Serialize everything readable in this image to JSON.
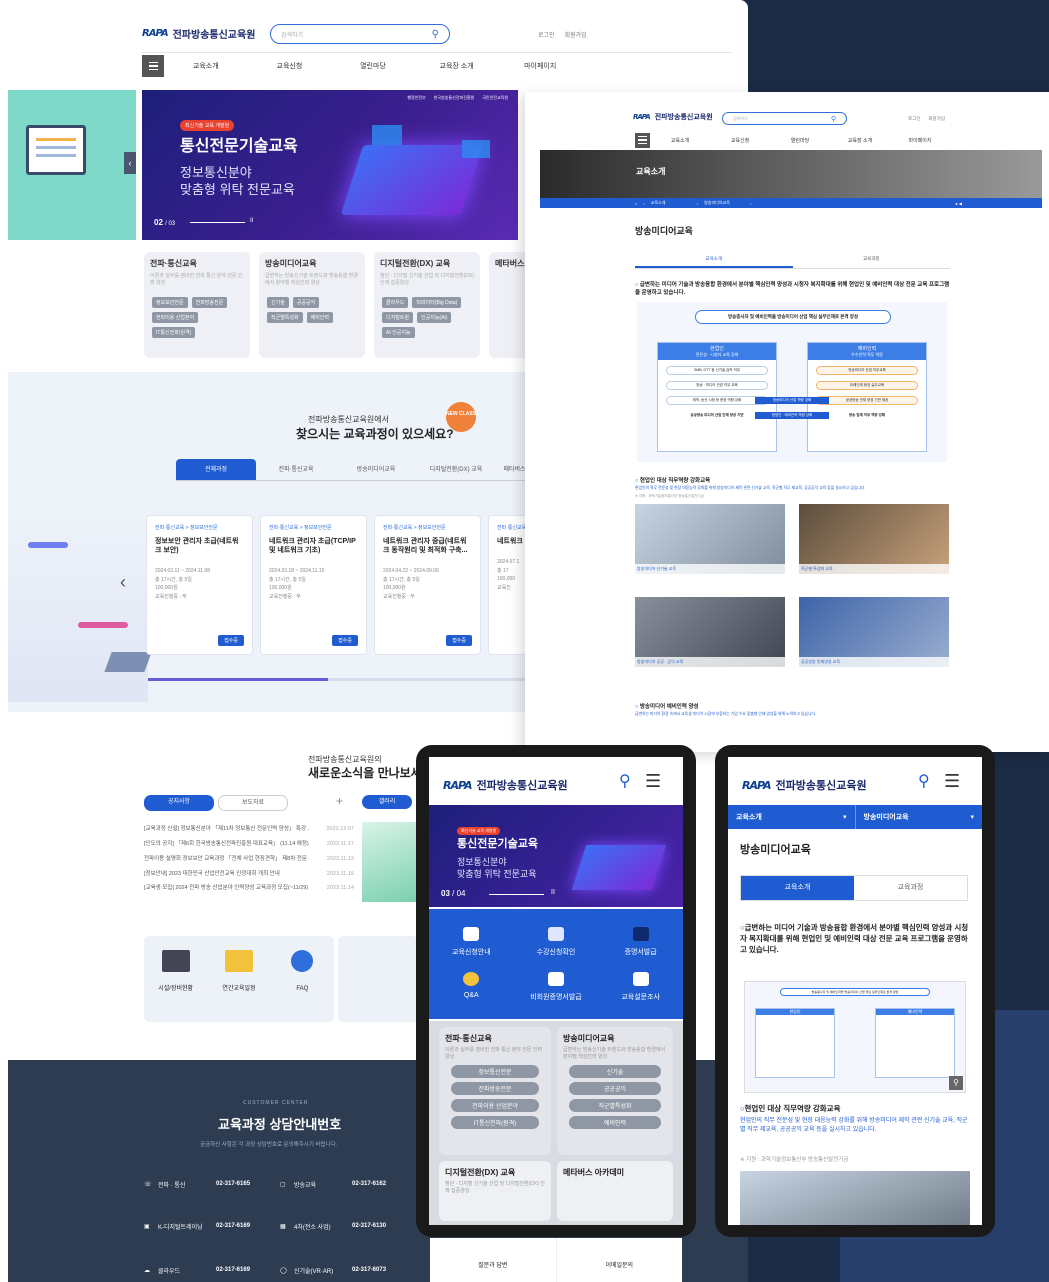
{
  "site": {
    "logo_mark": "RAPA",
    "logo_text": "전파방송통신교육원",
    "search_placeholder": "검색하기",
    "util": [
      "로그인",
      "회원가입"
    ]
  },
  "nav": [
    "교육소개",
    "교육신청",
    "열린마당",
    "교육장 소개",
    "마이페이지"
  ],
  "hero": {
    "badge": "최신기술 교육 개발원",
    "title": "통신전문기술교육",
    "sub1": "정보통신분야",
    "sub2": "맞춤형 위탁 전문교육",
    "counter": "02",
    "counter_total": "/ 03",
    "pause": "II",
    "partners": [
      "행정안전부",
      "한국방송통신전파진흥원",
      "국민안전교육원"
    ]
  },
  "categories": [
    {
      "title": "전파·통신교육",
      "desc": "이론과 실무를 겸비한 전파 통신 분야 전문 인력 양성",
      "tags": [
        "정보보안전문",
        "전파방송전문",
        "전파이용 산업분야",
        "IT통신전파(원격)"
      ]
    },
    {
      "title": "방송미디어교육",
      "desc": "급변하는 방송신기술 트렌드와 방송융합 환경에서 분야별 핵심인력 양성",
      "tags": [
        "신기술",
        "공공공익",
        "직군별특성화",
        "예비인력"
      ]
    },
    {
      "title": "디지털전환(DX) 교육",
      "desc": "첨단 · 디지털 신기술 산업 및 디지털전환(DX) 인재 집중양성",
      "tags": [
        "클라우드",
        "빅데이터(Big Data)",
        "디지털트윈",
        "인공지능(AI)",
        "AI 인공지능"
      ]
    },
    {
      "title": "메타버스 아카데미",
      "desc": "",
      "tags": []
    }
  ],
  "finder": {
    "pre": "전파방송통신교육원에서",
    "title": "찾으시는 교육과정이 있으세요?",
    "badge": "NEW CLASS",
    "tabs": [
      "전체과정",
      "전파·통신교육",
      "방송미디어교육",
      "디지털전환(DX) 교육",
      "메타버스"
    ],
    "courses": [
      {
        "cat": "전파·통신교육 > 정보보안전문",
        "title": "정보보안 관리자 초급(네트워크 보안)",
        "meta": [
          "2024.03.11 ~ 2024.11.08",
          "총 17시간, 총 5일",
          "100,000원",
          "교육진행중 : 무"
        ],
        "btn": "접수중"
      },
      {
        "cat": "전파·통신교육 > 정보보안전문",
        "title": "네트워크 관리자 초급(TCP/IP 및 네트워크 기초)",
        "meta": [
          "2024.03.18 ~ 2024.11.15",
          "총 17시간, 총 5일",
          "100,000원",
          "교육진행중 : 무"
        ],
        "btn": "접수중"
      },
      {
        "cat": "전파·통신교육 > 정보보안전문",
        "title": "네트워크 관리자 중급(네트워크 동작원리 및 최적화 구축...",
        "meta": [
          "2024.04.22 ~ 2024.09.06",
          "총 17시간, 총 5일",
          "100,000원",
          "교육진행중 : 무"
        ],
        "btn": "접수중"
      },
      {
        "cat": "전파·통신교육",
        "title": "네트워크",
        "meta": [
          "2024.07.1",
          "총 17",
          "100,000",
          "교육진"
        ],
        "btn": ""
      }
    ]
  },
  "news": {
    "pre": "전파방송통신교육원의",
    "title": "새로운소식을 만나보세요",
    "tabs": [
      "공지사항",
      "보도자료"
    ],
    "right_tab": "갤러리",
    "plus": "+",
    "items": [
      {
        "t": "[교육과정 신설] 정보통신분야 「제11차 정보통신 전문인력 양성」 특강 ...",
        "d": "2023.12.07"
      },
      {
        "t": "[인도의 공지] 「제6회 한국방송통신전파진흥원 대표교육」 (11.14 예정) 안...",
        "d": "2023.11.17"
      },
      {
        "t": "전파이용 설명회 정보보안 교육과정 「전체 사업 현장견학」 제8차 전문 ~",
        "d": "2023.11.13"
      },
      {
        "t": "[정보안내] 2023 대한민국 산업안전교육 인정대회 개최 안내",
        "d": "2023.11.15"
      },
      {
        "t": "[교육생 모집] 2024 전파 방송 산업분야 인력양성 교육과정 모집(~11/29)",
        "d": "2023.11.14"
      }
    ]
  },
  "quick_links": [
    "시설/장비현황",
    "연간교육일정",
    "FAQ"
  ],
  "contact": {
    "en": "CUSTOMER CENTER",
    "title": "교육과정 상담안내번호",
    "sub": "궁금하신 사항은 각 과정 상담번호로 문의해주시기 바랍니다.",
    "rows": [
      [
        {
          "label": "전파 · 통신",
          "tel": "02-317-6165"
        },
        {
          "label": "방송교육",
          "tel": "02-317-6162"
        }
      ],
      [
        {
          "label": "K-디지털트레이닝",
          "tel": "02-317-6169"
        },
        {
          "label": "4차(전소 사업)",
          "tel": "02-317-6130"
        }
      ],
      [
        {
          "label": "클라우드",
          "tel": "02-317-6169"
        },
        {
          "label": "신기술(VR·AR)",
          "tel": "02-317-6073"
        }
      ]
    ]
  },
  "sub_page": {
    "banner_title": "교육소개",
    "breadcrumb": [
      "교육소개",
      "방송미디어교육"
    ],
    "page_title": "방송미디어교육",
    "tabs": [
      "교육소개",
      "교육과정"
    ],
    "intro": "급변하는 미디어 기술과 방송융합 환경에서 분야별 핵심인력 양성과 시청자 복지확대를 위해 현업인 및 예비인력 대상 전문 교육 프로그램을 운영하고 있습니다.",
    "diagram_top": "방송종사자 및 예비인력을 방송미디어 산업 핵심 실무인재로 본격 양성",
    "left_head": "현업인",
    "left_sub": "전문성 · 시청자 교육 강화",
    "left_items": [
      "SMB, OTT 등 신기술 습득 직무",
      "방송 · 미디어 관련 직무 교육",
      "제작, 송신 시청 등 현장 역량 강화"
    ],
    "right_head": "예비인력",
    "right_sub": "우수인력 직무 역량",
    "right_items": [
      "방송미디어 산업 직무교육",
      "미래인재 현장 실무교육",
      "공공방송 인재 양성 기반 제공"
    ],
    "mid_items": [
      "방송미디어 산업 역량 강화",
      "현업인 · 예비인력 역량 강화"
    ],
    "bottom_left": "공공방송 미디어 산업 인재 양성 기반",
    "bottom_right": "방송 업계 직무 역량 강화",
    "section1": "현업인 대상 직무역량 강화교육",
    "section1_desc": "현업인의 직무 전문성 및 현장 대응능력 강화를 위해 방송미디어 제작 관련 신기술 교육, 직군별 직무 제교육, 공공공익 교육 등을 실시하고 있습니다.",
    "section1_note": "※ 지원 : 과학기술정보통신부 방송통신발전기금",
    "photos": [
      "방송미디어 신기술 교육",
      "직군별 특성화 교육",
      "방송미디어 공공 · 공익 교육",
      "공공방송 인재양성 교육"
    ],
    "section2": "방송미디어 예비인력 양성",
    "section2_desc": "급변하는 미디어 환경 속에서 교육생 미디어 시장에 부합하는 기업 수요 맞춤형 인재 양성을 위해 노력하고 있습니다."
  },
  "mobile1": {
    "hero_counter": "03",
    "hero_total": "/ 04",
    "quick": [
      "교육신청안내",
      "수강신청확인",
      "증명서발급",
      "Q&A",
      "비회원증명서발급",
      "교육설문조사"
    ],
    "cards": [
      {
        "title": "전파·통신교육",
        "desc": "이론과 실무를 겸비한 전파 통신 분야 전문 인력 양성",
        "tags": [
          "정보통신전문",
          "전파방송전문",
          "전파이용 산업분야",
          "IT통신전파(원격)"
        ]
      },
      {
        "title": "방송미디어교육",
        "desc": "급변하는 방송신기술 트렌드와 방송융합 환경에서 분야별 핵심인력 양성",
        "tags": [
          "신기술",
          "공공공익",
          "직군별특성화",
          "예비인력"
        ]
      },
      {
        "title": "디지털전환(DX) 교육",
        "desc": "첨단 · 디지털 신기술 산업 및 디지털전환(DX) 인재 집중양성",
        "tags": []
      },
      {
        "title": "메타버스 아카데미",
        "desc": "",
        "tags": []
      }
    ],
    "bottom": [
      "질문과 답변",
      "이메일문의"
    ]
  },
  "mobile2": {
    "select1": "교육소개",
    "select2": "방송미디어교육",
    "page_title": "방송미디어교육",
    "tabs": [
      "교육소개",
      "교육과정"
    ],
    "intro": "급변하는 미디어 기술과 방송융합 환경에서 분야별 핵심인력 양성과 시청자 복지확대를 위해 현업인 및 예비인력 대상 전문 교육 프로그램을 운영하고 있습니다.",
    "section1": "현업인 대상 직무역량 강화교육",
    "section1_desc": "현업인의 직무 전문성 및 현장 대응능력 강화를 위해 방송미디어 제작 관련 신기술 교육, 직군별 직무 제교육, 공공공익 교육 등을 실시하고 있습니다.",
    "note": "※ 지원 : 과학기술정보통신부 방송통신발전기금"
  }
}
